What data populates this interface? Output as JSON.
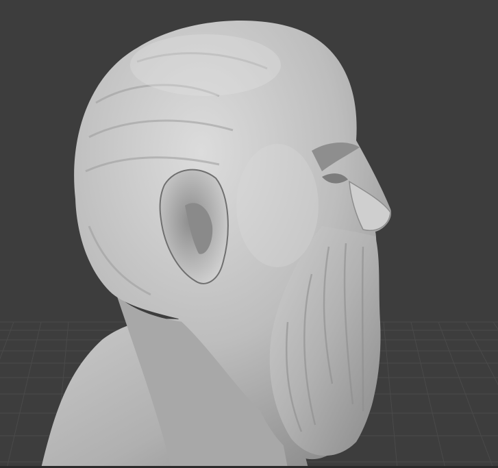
{
  "viewport": {
    "background_color": "#3d3d3d",
    "grid_line_color": "#4a4a4a",
    "grid_major_color": "#505050",
    "model_base_color": "#b4b4b4",
    "model_highlight_color": "#d8d8d8",
    "model_shadow_color": "#7a7a7a",
    "object": "sculpted-bust-bearded-head",
    "shading": "matcap-clay"
  }
}
